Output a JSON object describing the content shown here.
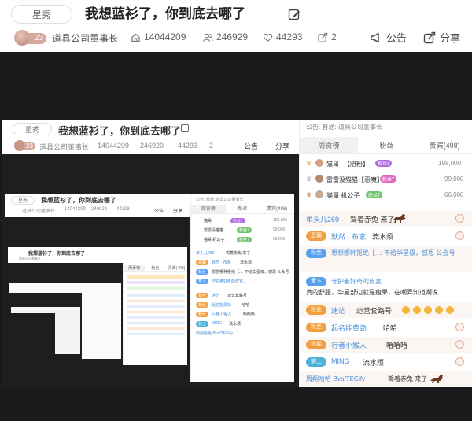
{
  "header": {
    "category_tag": "星秀",
    "title": "我想蓝衫了，你到底去哪了",
    "level": "23",
    "host_name": "道具公司董事长",
    "stats": {
      "views": "14044209",
      "followers": "246929",
      "likes": "44293",
      "shares": "2"
    },
    "notice_label": "公告",
    "share_label": "分享"
  },
  "inner": {
    "category_tag": "星秀",
    "title": "我想蓝衫了，你到底去哪了",
    "level": "23",
    "host_name": "道具公司董事长",
    "stats": {
      "views": "14044209",
      "followers": "246929",
      "likes": "44293",
      "shares": "2"
    },
    "notice_label": "公告",
    "share_label": "分享",
    "notice_line": "公告: 普通: 道具公司董事长",
    "tabs": [
      "周贡榜",
      "粉丝",
      "贵宾(498)"
    ],
    "ranks": [
      {
        "name": "猫哥",
        "tag": "粉丝1",
        "title": "【陪粉】",
        "value": "198,000"
      },
      {
        "name": "雷雷没猫猫",
        "tag": "粉丝7",
        "title": "【恶魔】",
        "value": "99,000"
      },
      {
        "name": "猫哥 机公子",
        "tag": "粉丝7",
        "title": "",
        "value": "66,000"
      }
    ],
    "chat": [
      {
        "badge": "",
        "name": "单头儿269",
        "text": "驾着赤兔 来了"
      },
      {
        "badge": "恶霸",
        "name": "默然 · 布家",
        "text": "流水烦"
      },
      {
        "badge": "粉丝",
        "name": "",
        "text": "想想哪种拒绝【...: 不给华星级，感恩 公会号"
      },
      {
        "badge": "萝卜",
        "name": "守护者好奇的皮室...",
        "text": "真的舒服，华星部边就是瘦果，在嘲弄知道啊说"
      },
      {
        "badge": "粉丝",
        "name": "迷茫",
        "text": "运营套路号"
      },
      {
        "badge": "粉丝",
        "name": "起名能费劲",
        "text": "哈哈"
      },
      {
        "badge": "粉丝",
        "name": "行者小猴人",
        "text": "哈哈哈"
      },
      {
        "badge": "骑士",
        "name": "MING",
        "text": "流水烦"
      },
      {
        "badge": "",
        "name": "周翔哈哈·BvafTEGify",
        "text": "驾着赤兔 来了"
      }
    ]
  }
}
